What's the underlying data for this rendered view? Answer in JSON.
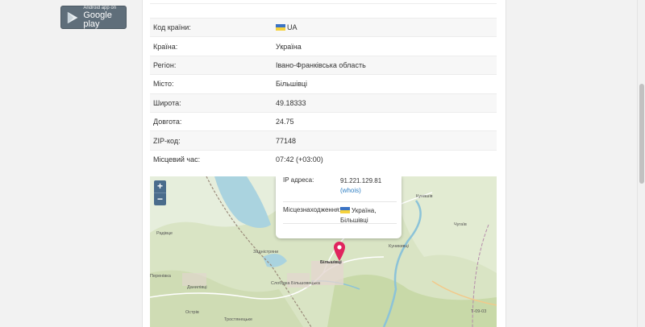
{
  "google_play": {
    "small": "Android app on",
    "big": "Google play"
  },
  "info": {
    "rows": [
      {
        "key": "Код країни:",
        "value": "UA",
        "flag": true
      },
      {
        "key": "Країна:",
        "value": "Україна"
      },
      {
        "key": "Регіон:",
        "value": "Івано-Франківська область"
      },
      {
        "key": "Місто:",
        "value": "Більшівці"
      },
      {
        "key": "Широта:",
        "value": "49.18333"
      },
      {
        "key": "Довгота:",
        "value": "24.75"
      },
      {
        "key": "ZIP-код:",
        "value": "77148"
      },
      {
        "key": "Місцевий час:",
        "value": "07:42 (+03:00)"
      }
    ]
  },
  "map": {
    "zoom_in": "+",
    "zoom_out": "−",
    "popup": {
      "ip_label": "IP адреса:",
      "ip_value": "91.221.129.81",
      "whois_link": "(whois)",
      "location_label": "Місцезнаходження:",
      "location_value": "Україна, Більшівці"
    },
    "labels": {
      "radivtse": "Радівце",
      "zadnistriany": "Задністряни",
      "bilshivtsi": "Більшівці",
      "perenivka": "Перенівка",
      "danylivtsi": "Данилівці",
      "slobidka": "Слобідка Більшовецька",
      "ostriv": "Острів",
      "kunashiv": "Кунашів",
      "kunykivtsi": "Куникивці",
      "chuhaiv": "Чугаїв",
      "road": "Т-09-03",
      "tovmach": "Тростянецьке"
    }
  },
  "colors": {
    "accent": "#2f7fc3",
    "pin": "#e0245e",
    "zoom": "#4a6c8c",
    "badge": "#5f6e7a"
  }
}
